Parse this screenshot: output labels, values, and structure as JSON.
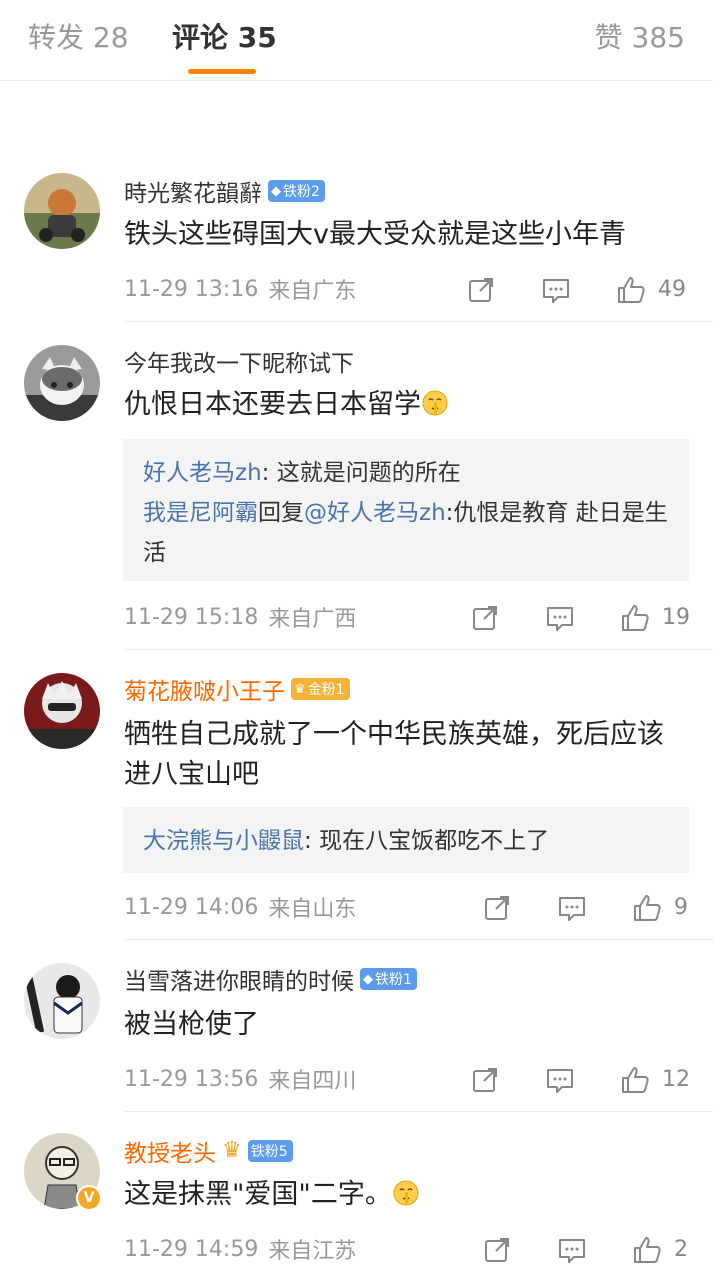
{
  "tabs": {
    "repost": "转发 28",
    "comment_label": "评论",
    "comment_count": "35",
    "like": "赞 385"
  },
  "colors": {
    "accent": "#ff8200",
    "username_orange": "#ff6a00",
    "reply_name": "#4a74ad",
    "iron_badge": "#5d9cec",
    "gold_badge": "#f5b335"
  },
  "comments": [
    {
      "username": "時光繁花韻辭",
      "badge": "铁粉2",
      "text": "铁头这些碍国大v最大受众就是这些小年青",
      "time": "11-29 13:16",
      "location": "来自广东",
      "likes": "49"
    },
    {
      "username": "今年我改一下昵称试下",
      "text": "仇恨日本还要去日本留学",
      "emoji": "shush-emoji",
      "replies": [
        {
          "name": "好人老马zh",
          "sep": ": ",
          "text": "这就是问题的所在"
        },
        {
          "name": "我是尼阿霸",
          "mid": "回复",
          "target": "@好人老马zh",
          "sep": ":",
          "text": "仇恨是教育 赴日是生活"
        }
      ],
      "time": "11-29 15:18",
      "location": "来自广西",
      "likes": "19"
    },
    {
      "username": "菊花腋啵小王子",
      "badge": "金粉1",
      "text": "牺牲自己成就了一个中华民族英雄，死后应该进八宝山吧",
      "replies": [
        {
          "name": "大浣熊与小鼹鼠",
          "sep": ": ",
          "text": "现在八宝饭都吃不上了"
        }
      ],
      "time": "11-29 14:06",
      "location": "来自山东",
      "likes": "9"
    },
    {
      "username": "当雪落进你眼睛的时候",
      "badge": "铁粉1",
      "text": "被当枪使了",
      "time": "11-29 13:56",
      "location": "来自四川",
      "likes": "12"
    },
    {
      "username": "教授老头",
      "badge": "铁粉5",
      "avatar_badge": "V",
      "text": "这是抹黑\"爱国\"二字。",
      "emoji": "shush-emoji",
      "time": "11-29 14:59",
      "location": "来自江苏",
      "likes": "2"
    }
  ]
}
